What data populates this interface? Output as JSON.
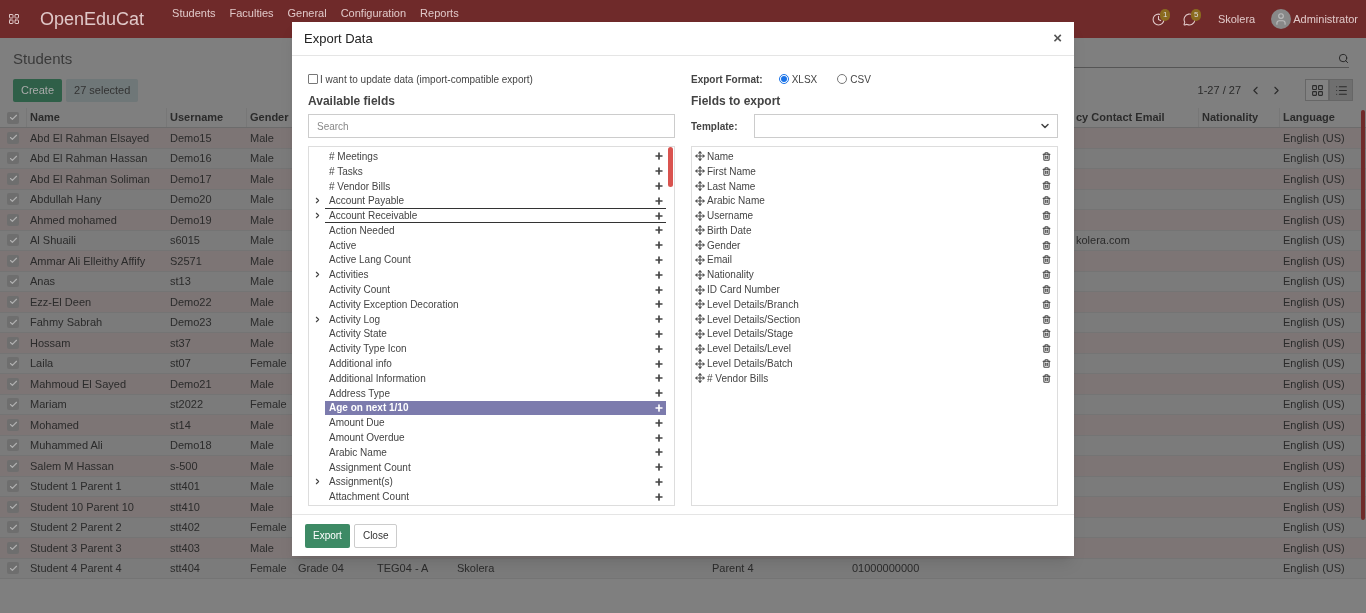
{
  "topbar": {
    "brand": "OpenEduCat",
    "menu": [
      "Students",
      "Faculties",
      "General",
      "Configuration",
      "Reports"
    ],
    "activity_count": "1",
    "message_count": "5",
    "company": "Skolera",
    "user": "Administrator"
  },
  "control_panel": {
    "breadcrumb": "Students",
    "create": "Create",
    "selection": "27 selected",
    "pager": "1-27 / 27",
    "views": [
      {
        "kind": "kanban",
        "selected": false
      },
      {
        "kind": "list",
        "selected": true
      }
    ]
  },
  "table": {
    "all_selected": true,
    "columns": [
      "Name",
      "Username",
      "Gender",
      null,
      null,
      null,
      null,
      null,
      "cy Contact Email",
      "Nationality",
      "Language"
    ],
    "rows": [
      {
        "selected": true,
        "cells": [
          "Abd El Rahman Elsayed",
          "Demo15",
          "Male",
          null,
          null,
          null,
          null,
          null,
          null,
          null,
          "English (US)"
        ]
      },
      {
        "selected": true,
        "cells": [
          "Abd El Rahman Hassan",
          "Demo16",
          "Male",
          null,
          null,
          null,
          null,
          null,
          null,
          null,
          "English (US)"
        ]
      },
      {
        "selected": true,
        "cells": [
          "Abd El Rahman Soliman",
          "Demo17",
          "Male",
          null,
          null,
          null,
          null,
          null,
          null,
          null,
          "English (US)"
        ]
      },
      {
        "selected": true,
        "cells": [
          "Abdullah Hany",
          "Demo20",
          "Male",
          null,
          null,
          null,
          null,
          null,
          null,
          null,
          "English (US)"
        ]
      },
      {
        "selected": true,
        "cells": [
          "Ahmed mohamed",
          "Demo19",
          "Male",
          null,
          null,
          null,
          null,
          null,
          null,
          null,
          "English (US)"
        ]
      },
      {
        "selected": true,
        "cells": [
          "Al Shuaili",
          "s6015",
          "Male",
          null,
          null,
          null,
          null,
          null,
          "kolera.com",
          null,
          "English (US)"
        ]
      },
      {
        "selected": true,
        "cells": [
          "Ammar Ali Elleithy Affify",
          "S2571",
          "Male",
          null,
          null,
          null,
          null,
          null,
          null,
          null,
          "English (US)"
        ]
      },
      {
        "selected": true,
        "cells": [
          "Anas",
          "st13",
          "Male",
          null,
          null,
          null,
          null,
          null,
          null,
          null,
          "English (US)"
        ]
      },
      {
        "selected": true,
        "cells": [
          "Ezz-El Deen",
          "Demo22",
          "Male",
          null,
          null,
          null,
          null,
          null,
          null,
          null,
          "English (US)"
        ]
      },
      {
        "selected": true,
        "cells": [
          "Fahmy Sabrah",
          "Demo23",
          "Male",
          null,
          null,
          null,
          null,
          null,
          null,
          null,
          "English (US)"
        ]
      },
      {
        "selected": true,
        "cells": [
          "Hossam",
          "st37",
          "Male",
          null,
          null,
          null,
          null,
          null,
          null,
          null,
          "English (US)"
        ]
      },
      {
        "selected": true,
        "cells": [
          "Laila",
          "st07",
          "Female",
          null,
          null,
          null,
          null,
          null,
          null,
          null,
          "English (US)"
        ]
      },
      {
        "selected": true,
        "cells": [
          "Mahmoud El Sayed",
          "Demo21",
          "Male",
          null,
          null,
          null,
          null,
          null,
          null,
          null,
          "English (US)"
        ]
      },
      {
        "selected": true,
        "cells": [
          "Mariam",
          "st2022",
          "Female",
          null,
          null,
          null,
          null,
          null,
          null,
          null,
          "English (US)"
        ]
      },
      {
        "selected": true,
        "cells": [
          "Mohamed",
          "st14",
          "Male",
          null,
          null,
          null,
          null,
          null,
          null,
          null,
          "English (US)"
        ]
      },
      {
        "selected": true,
        "cells": [
          "Muhammed Ali",
          "Demo18",
          "Male",
          null,
          null,
          null,
          null,
          null,
          null,
          null,
          "English (US)"
        ]
      },
      {
        "selected": true,
        "cells": [
          "Salem M Hassan",
          "s-500",
          "Male",
          null,
          null,
          null,
          null,
          null,
          null,
          null,
          "English (US)"
        ]
      },
      {
        "selected": true,
        "cells": [
          "Student 1 Parent 1",
          "stt401",
          "Male",
          null,
          null,
          null,
          null,
          null,
          null,
          null,
          "English (US)"
        ]
      },
      {
        "selected": true,
        "cells": [
          "Student 10 Parent 10",
          "stt410",
          "Male",
          null,
          null,
          null,
          null,
          null,
          null,
          null,
          "English (US)"
        ]
      },
      {
        "selected": true,
        "cells": [
          "Student 2 Parent 2",
          "stt402",
          "Female",
          null,
          null,
          null,
          null,
          null,
          null,
          null,
          "English (US)"
        ]
      },
      {
        "selected": true,
        "cells": [
          "Student 3 Parent 3",
          "stt403",
          "Male",
          null,
          null,
          null,
          null,
          null,
          null,
          null,
          "English (US)"
        ]
      },
      {
        "selected": true,
        "cells": [
          "Student 4 Parent 4",
          "stt404",
          "Female",
          "Grade 04",
          "TEG04 - A",
          "Skolera",
          "Parent 4",
          "01000000000",
          null,
          null,
          "English (US)"
        ]
      }
    ]
  },
  "dialog": {
    "title": "Export Data",
    "close": "×",
    "import_compatible": {
      "label": "I want to update data (import-compatible export)",
      "checked": false
    },
    "format_label": "Export Format:",
    "formats": [
      {
        "label": "XLSX",
        "selected": true
      },
      {
        "label": "CSV",
        "selected": false
      }
    ],
    "available_title": "Available fields",
    "search": {
      "placeholder": "Search"
    },
    "available_fields": [
      {
        "label": "# Meetings",
        "expandable": false,
        "selected": false,
        "focused": false
      },
      {
        "label": "# Tasks",
        "expandable": false,
        "selected": false,
        "focused": false
      },
      {
        "label": "# Vendor Bills",
        "expandable": false,
        "selected": false,
        "focused": false
      },
      {
        "label": "Account Payable",
        "expandable": true,
        "selected": false,
        "focused": false
      },
      {
        "label": "Account Receivable",
        "expandable": true,
        "selected": false,
        "focused": true
      },
      {
        "label": "Action Needed",
        "expandable": false,
        "selected": false,
        "focused": false
      },
      {
        "label": "Active",
        "expandable": false,
        "selected": false,
        "focused": false
      },
      {
        "label": "Active Lang Count",
        "expandable": false,
        "selected": false,
        "focused": false
      },
      {
        "label": "Activities",
        "expandable": true,
        "selected": false,
        "focused": false
      },
      {
        "label": "Activity Count",
        "expandable": false,
        "selected": false,
        "focused": false
      },
      {
        "label": "Activity Exception Decoration",
        "expandable": false,
        "selected": false,
        "focused": false
      },
      {
        "label": "Activity Log",
        "expandable": true,
        "selected": false,
        "focused": false
      },
      {
        "label": "Activity State",
        "expandable": false,
        "selected": false,
        "focused": false
      },
      {
        "label": "Activity Type Icon",
        "expandable": false,
        "selected": false,
        "focused": false
      },
      {
        "label": "Additional info",
        "expandable": false,
        "selected": false,
        "focused": false
      },
      {
        "label": "Additional Information",
        "expandable": false,
        "selected": false,
        "focused": false
      },
      {
        "label": "Address Type",
        "expandable": false,
        "selected": false,
        "focused": false
      },
      {
        "label": "Age on next 1/10",
        "expandable": false,
        "selected": true,
        "focused": false
      },
      {
        "label": "Amount Due",
        "expandable": false,
        "selected": false,
        "focused": false
      },
      {
        "label": "Amount Overdue",
        "expandable": false,
        "selected": false,
        "focused": false
      },
      {
        "label": "Arabic Name",
        "expandable": false,
        "selected": false,
        "focused": false
      },
      {
        "label": "Assignment Count",
        "expandable": false,
        "selected": false,
        "focused": false
      },
      {
        "label": "Assignment(s)",
        "expandable": true,
        "selected": false,
        "focused": false
      },
      {
        "label": "Attachment Count",
        "expandable": false,
        "selected": false,
        "focused": false
      }
    ],
    "export_title": "Fields to export",
    "template_label": "Template:",
    "export_fields": [
      "Name",
      "First Name",
      "Last Name",
      "Arabic Name",
      "Username",
      "Birth Date",
      "Gender",
      "Email",
      "Nationality",
      "ID Card Number",
      "Level Details/Branch",
      "Level Details/Section",
      "Level Details/Stage",
      "Level Details/Level",
      "Level Details/Batch",
      "# Vendor Bills"
    ],
    "buttons": [
      {
        "label": "Export",
        "kind": "primary"
      },
      {
        "label": "Close",
        "kind": "secondary"
      }
    ]
  }
}
